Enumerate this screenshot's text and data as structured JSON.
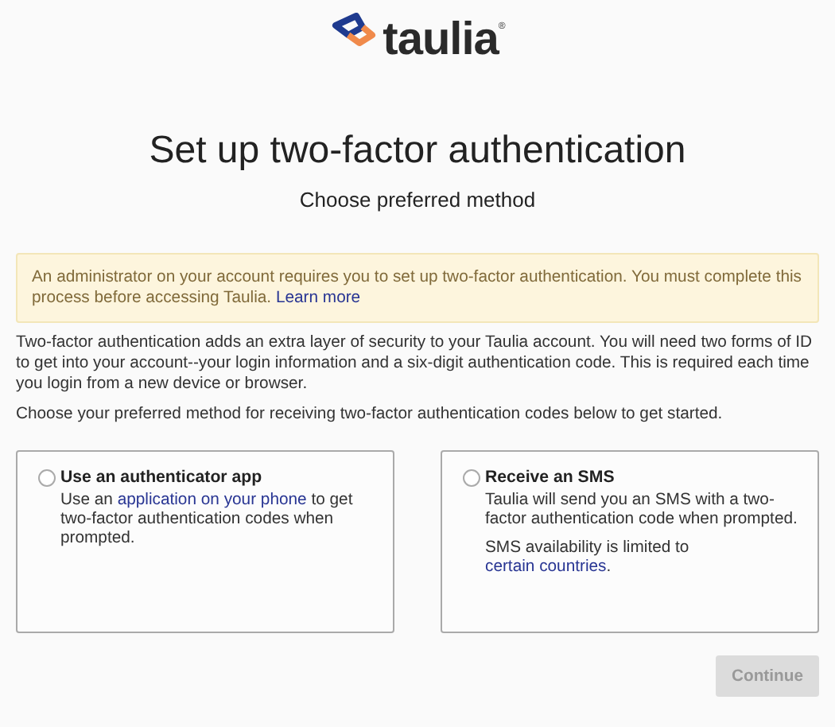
{
  "logo": {
    "text": "taulia$^{®}$"
  },
  "title": "Set up two-factor authentication",
  "subtitle": "Choose preferred method",
  "alert": [
    {
      "kind": "text",
      "text": "An administrator on your account requires you to set up two-factor authentication. You must complete this process before accessing Taulia. "
    },
    {
      "kind": "link",
      "text": "Learn more"
    }
  ],
  "intro": "Two-factor authentication adds an extra layer of security to your Taulia account. You will need two forms of ID to get into your account--your login information and a six-digit authentication code. This is required each time you login from a new device or browser.",
  "instruction": "Choose your preferred method for receiving two-factor authentication codes below to get started.",
  "methods": [
    {
      "label": "Use an authenticator app",
      "selected": false,
      "paragraphs": [
        [
          {
            "kind": "text",
            "text": "Use an "
          },
          {
            "kind": "link",
            "text": "application on your phone"
          },
          {
            "kind": "text",
            "text": " to get two-factor authentication codes when prompted."
          }
        ]
      ]
    },
    {
      "label": "Receive an SMS",
      "selected": false,
      "paragraphs": [
        [
          {
            "kind": "text",
            "text": "Taulia will send you an SMS with a two-factor authentication code when prompted."
          }
        ],
        [
          {
            "kind": "text",
            "text": "SMS availability is limited to "
          },
          {
            "kind": "link",
            "text": "certain countries"
          },
          {
            "kind": "text",
            "text": "."
          }
        ]
      ]
    }
  ],
  "continue_button": {
    "label": "Continue",
    "disabled": true
  }
}
